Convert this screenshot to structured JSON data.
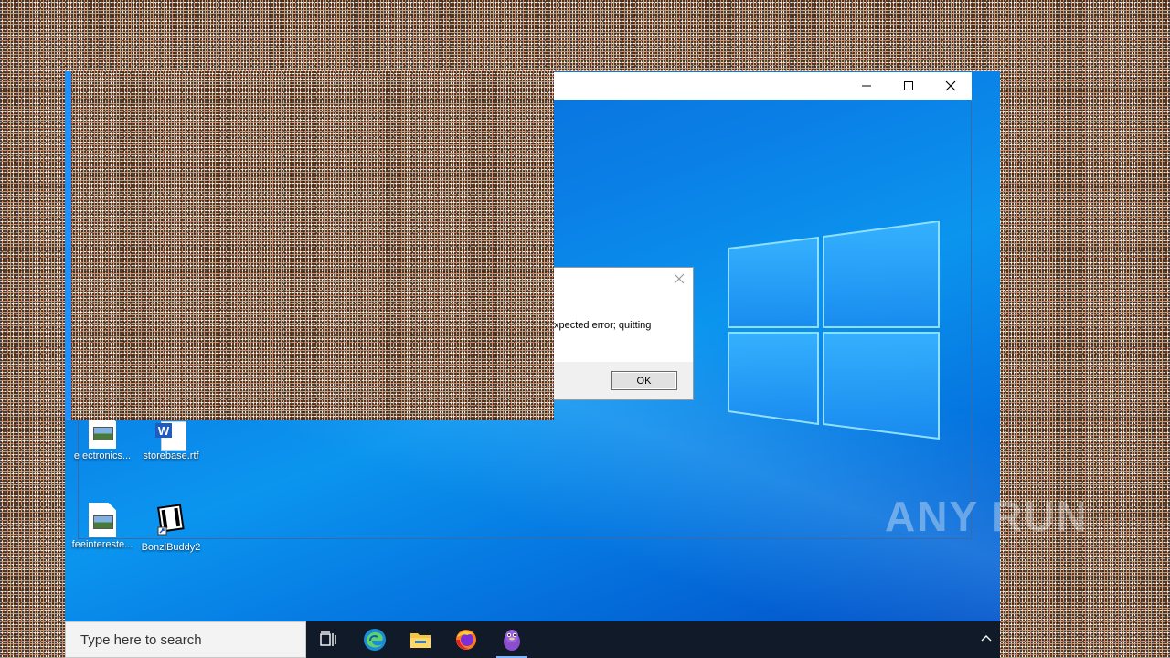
{
  "window": {
    "minimize_icon": "minimize-icon",
    "maximize_icon": "maximize-icon",
    "close_icon": "close-icon"
  },
  "dialog": {
    "message": "xpected error; quitting",
    "ok_label": "OK",
    "close_icon": "close-icon"
  },
  "desktop": {
    "icons": [
      {
        "label": "e ectronics...",
        "icon": "image-file-icon"
      },
      {
        "label": "storebase.rtf",
        "icon": "word-document-icon"
      },
      {
        "label": "feeintereste...",
        "icon": "image-file-icon"
      },
      {
        "label": "BonziBuddy2",
        "icon": "shortcut-film-icon"
      }
    ],
    "watermark": "ANY RUN"
  },
  "taskbar": {
    "search_placeholder": "Type here to search",
    "apps": [
      {
        "name": "task-view",
        "icon": "task-view-icon"
      },
      {
        "name": "edge",
        "icon": "edge-icon"
      },
      {
        "name": "file-explorer",
        "icon": "folder-icon"
      },
      {
        "name": "firefox",
        "icon": "firefox-icon"
      },
      {
        "name": "bonzibuddy",
        "icon": "bonzi-icon",
        "active": true
      }
    ],
    "tray_icon": "chevron-up-icon"
  }
}
